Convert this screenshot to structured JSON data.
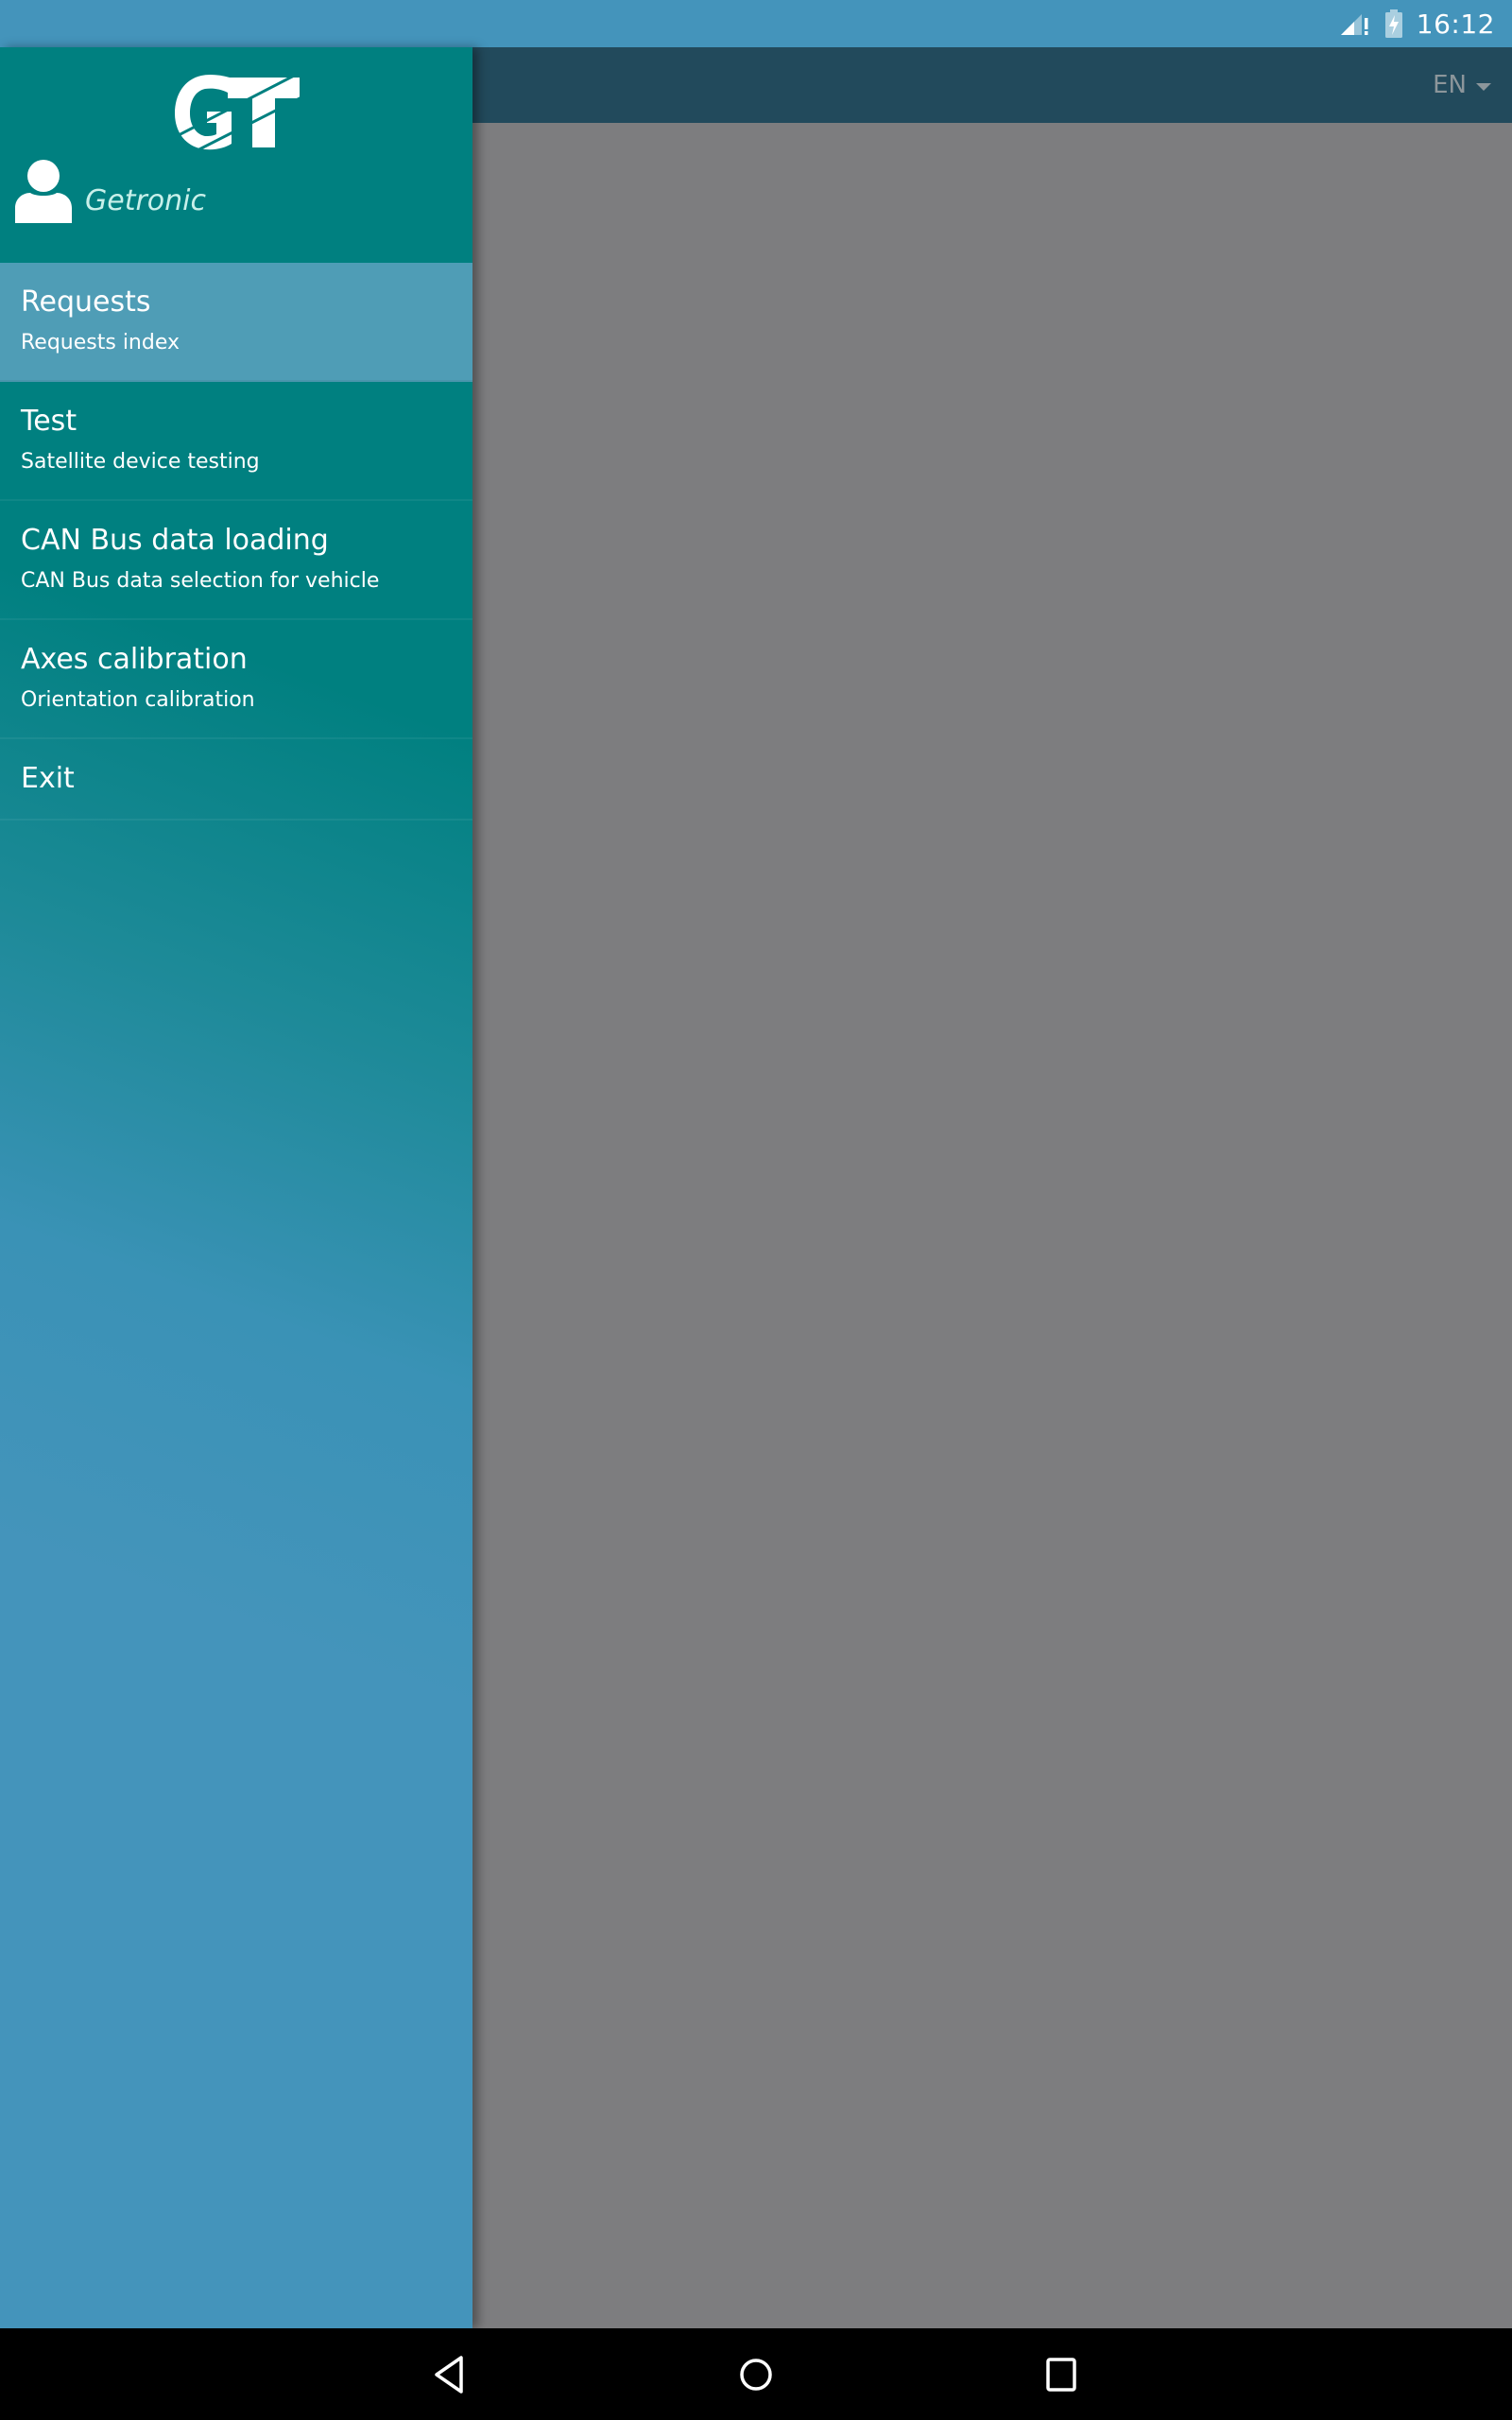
{
  "status_bar": {
    "time": "16:12",
    "icons": [
      "signal-no-data-icon",
      "battery-charging-icon"
    ]
  },
  "app_bar": {
    "language": "EN"
  },
  "drawer": {
    "logo_text": "GT",
    "user_name": "Getronic",
    "items": [
      {
        "title": "Requests",
        "subtitle": "Requests index",
        "selected": true
      },
      {
        "title": "Test",
        "subtitle": "Satellite device testing",
        "selected": false
      },
      {
        "title": "CAN Bus data loading",
        "subtitle": "CAN Bus data selection for vehicle",
        "selected": false
      },
      {
        "title": "Axes calibration",
        "subtitle": "Orientation calibration",
        "selected": false
      },
      {
        "title": "Exit",
        "selected": false
      }
    ]
  },
  "nav_bar": {
    "buttons": [
      "back",
      "home",
      "recents"
    ]
  },
  "colors": {
    "status_bar": "#4494bb",
    "app_bar_dimmed": "#224a5c",
    "drawer_top": "#008080",
    "drawer_bottom": "#4494bb",
    "selected_item": "#4f9db6",
    "scrim": "#7d7d7f"
  }
}
